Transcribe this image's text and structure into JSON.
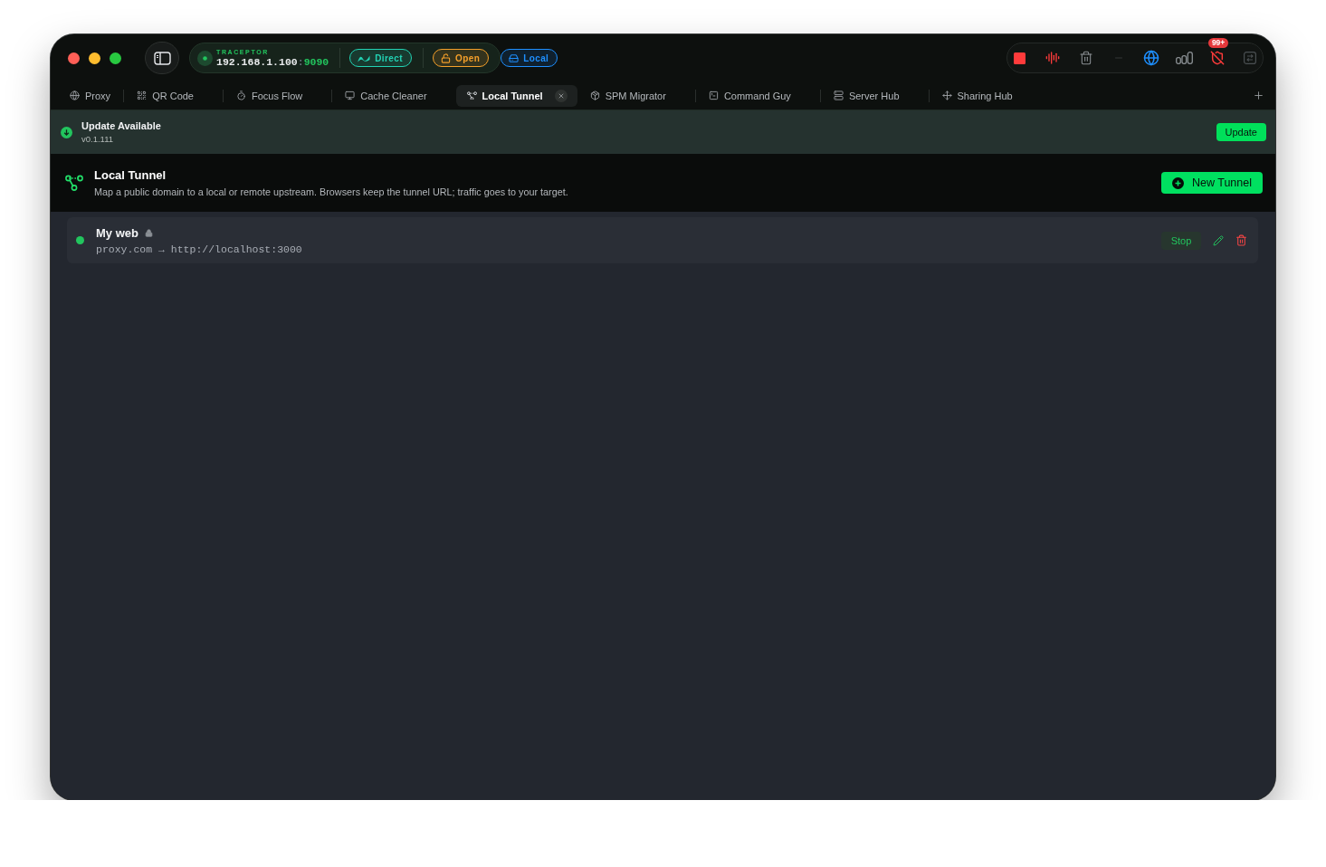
{
  "status": {
    "app": "TRACEPTOR",
    "host": "192.168.1.100",
    "separator": ":",
    "port": "9090",
    "modes": [
      {
        "kind": "direct",
        "label": "Direct",
        "color": "#22d3b4"
      },
      {
        "kind": "open",
        "label": "Open",
        "color": "#f5a02a"
      },
      {
        "kind": "local",
        "label": "Local",
        "color": "#1e8fff"
      }
    ]
  },
  "toolbar": {
    "badge": "99+"
  },
  "tabs": [
    {
      "label": "Proxy",
      "selected": false
    },
    {
      "label": "QR Code",
      "selected": false
    },
    {
      "label": "Focus Flow",
      "selected": false
    },
    {
      "label": "Cache Cleaner",
      "selected": false
    },
    {
      "label": "Local Tunnel",
      "selected": true
    },
    {
      "label": "SPM Migrator",
      "selected": false
    },
    {
      "label": "Command Guy",
      "selected": false
    },
    {
      "label": "Server Hub",
      "selected": false
    },
    {
      "label": "Sharing Hub",
      "selected": false
    }
  ],
  "update_banner": {
    "title": "Update Available",
    "version": "v0.1.111",
    "button": "Update"
  },
  "page_header": {
    "title": "Local Tunnel",
    "description": "Map a public domain to a local or remote upstream. Browsers keep the tunnel URL; traffic goes to your target.",
    "button": "New Tunnel"
  },
  "tunnels": [
    {
      "name": "My web",
      "locked": true,
      "running": true,
      "route": "proxy.com → http://localhost:3000",
      "action": "Stop"
    }
  ]
}
